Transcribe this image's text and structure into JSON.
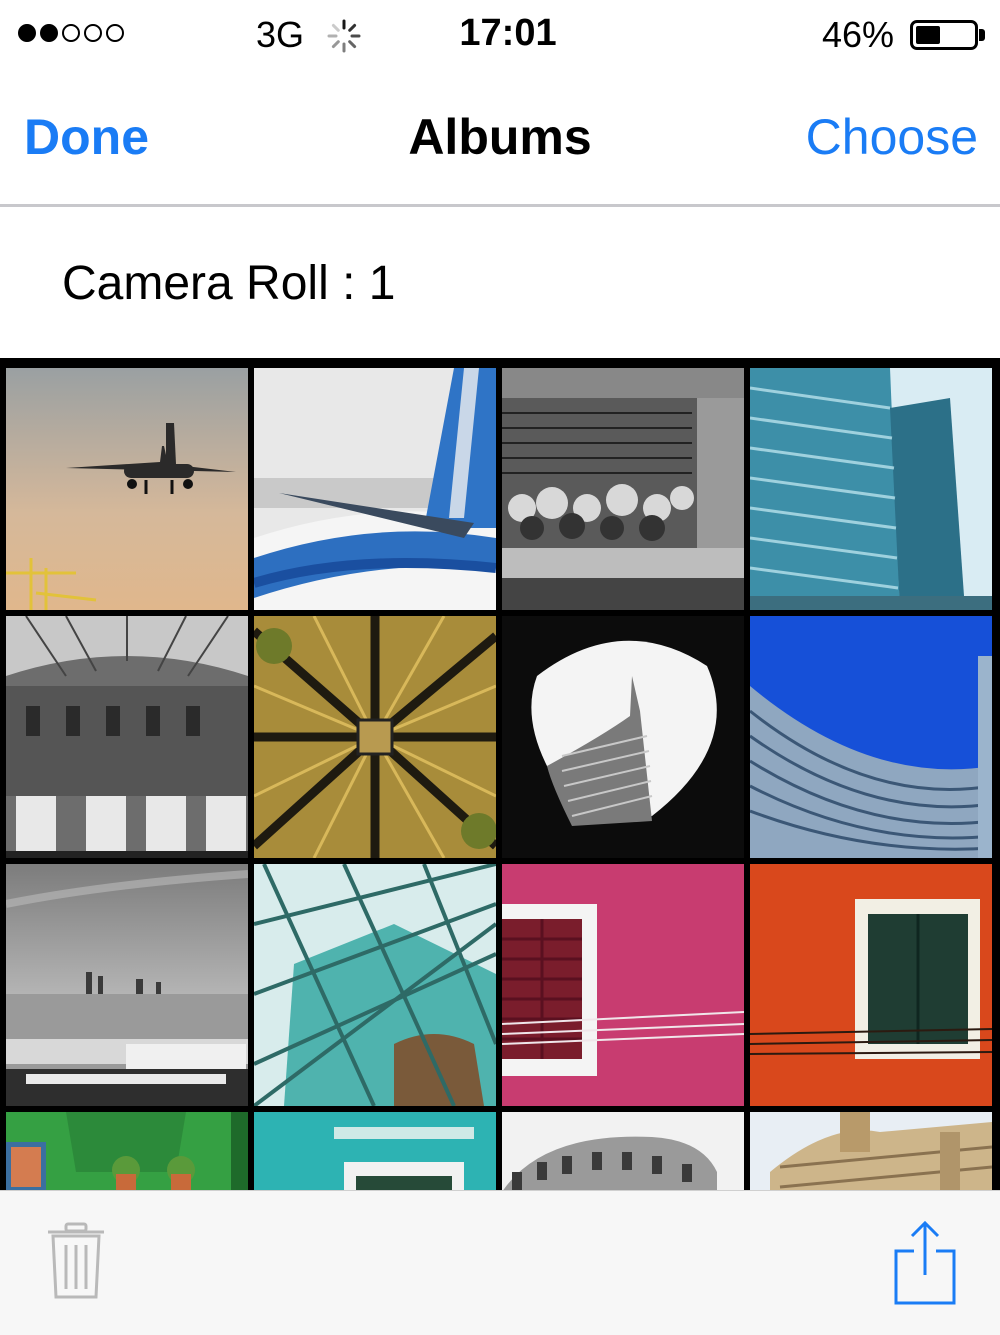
{
  "status": {
    "carrier": "3G",
    "time": "17:01",
    "battery_percent": "46%",
    "signal_bars_filled": 2,
    "signal_bars_total": 5,
    "battery_level": 0.46
  },
  "nav": {
    "left_label": "Done",
    "title": "Albums",
    "right_label": "Choose"
  },
  "album": {
    "heading": "Camera Roll : 1"
  },
  "photos": [
    {
      "name": "airplane-landing"
    },
    {
      "name": "airplane-tail"
    },
    {
      "name": "flower-market"
    },
    {
      "name": "glass-tower"
    },
    {
      "name": "galleria-arcade"
    },
    {
      "name": "aerial-star-city"
    },
    {
      "name": "tower-through-oculus"
    },
    {
      "name": "curved-blue-building"
    },
    {
      "name": "city-skyline"
    },
    {
      "name": "glass-canopy"
    },
    {
      "name": "pink-wall-window"
    },
    {
      "name": "orange-wall-window"
    },
    {
      "name": "green-house-flowers"
    },
    {
      "name": "teal-house-window"
    },
    {
      "name": "colosseum"
    },
    {
      "name": "ornate-facade"
    }
  ],
  "toolbar": {
    "icons": [
      "trash-icon",
      "share-icon"
    ]
  },
  "colors": {
    "accent": "#1a7cf5"
  }
}
